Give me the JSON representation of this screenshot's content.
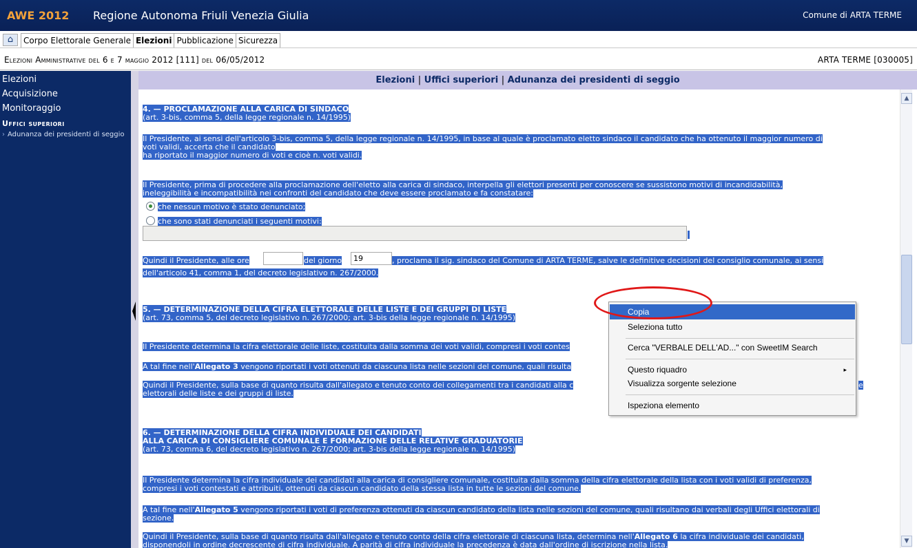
{
  "header": {
    "logo": "AWE 2012",
    "region": "Regione Autonoma Friuli Venezia Giulia",
    "comune": "Comune di ARTA TERME"
  },
  "menu": {
    "tabs": [
      "Corpo Elettorale Generale",
      "Elezioni",
      "Pubblicazione",
      "Sicurezza"
    ],
    "active_tab": "Elezioni"
  },
  "infobar": {
    "election": "Elezioni Amministrative del 6 e 7 maggio 2012 [111] del 06/05/2012",
    "comune_code": "ARTA TERME [030005]"
  },
  "sidebar": {
    "items": [
      "Elezioni",
      "Acquisizione",
      "Monitoraggio"
    ],
    "section": "Uffici superiori",
    "subitem": "Adunanza dei presidenti di seggio"
  },
  "breadcrumb": {
    "part1": "Elezioni",
    "sep": "|",
    "part2": "Uffici superiori",
    "part3": "Adunanza dei presidenti di seggio"
  },
  "content": {
    "s4_title": "4. — PROCLAMAZIONE ALLA CARICA DI SINDACO",
    "s4_sub": "(art. 3-bis, comma 5, della legge regionale n. 14/1995)",
    "s4_p1_l1": "Il Presidente, ai sensi dell'articolo 3-bis, comma 5, della legge regionale n. 14/1995, in base al quale è proclamato eletto sindaco il candidato che ha ottenuto il maggior numero di",
    "s4_p1_l2": "voti validi, accerta che il candidato",
    "s4_p1_l3": "ha riportato il maggior numero di voti e cioè n. voti validi.",
    "s4_p2_l1": "Il Presidente, prima di procedere alla proclamazione dell'eletto alla carica di sindaco, interpella gli elettori presenti per conoscere se sussistono motivi di incandidabilità,",
    "s4_p2_l2": "ineleggibilità e incompatibilità nei confronti del candidato che deve essere proclamato e fa constatare:",
    "radio1": "che nessun motivo è stato denunciato;",
    "radio2": "che sono stati denunciati i seguenti motivi:",
    "s4_p3_a": "Quindi il Presidente, alle ore",
    "s4_p3_b": "del giorno",
    "giorno_value": "19",
    "s4_p3_c": ", proclama il sig. sindaco del Comune di ARTA TERME, salve le definitive decisioni del consiglio comunale, ai sensi",
    "s4_p3_l2": "dell'articolo 41, comma 1, del decreto legislativo n. 267/2000.",
    "s5_title": "5. — DETERMINAZIONE DELLA CIFRA ELETTORALE DELLE LISTE E DEI GRUPPI DI LISTE",
    "s5_sub": "(art. 73, comma 5, del decreto legislativo n. 267/2000; art. 3-bis della legge regionale n. 14/1995)",
    "s5_p1": "Il Presidente determina la cifra elettorale delle liste, costituita dalla somma dei voti validi, compresi i voti contes",
    "s5_p2_a": "A tal fine nell'",
    "s5_p2_b": "Allegato 3",
    "s5_p2_c": " vengono riportati i voti ottenuti da ciascuna lista nelle sezioni del comune, quali risulta",
    "s5_p3_l1": "Quindi il Presidente, sulla base di quanto risulta dall'allegato e tenuto conto dei collegamenti tra i candidati alla c",
    "s5_p3_l1_tail": "e",
    "s5_p3_l2": "elettorali delle liste e dei gruppi di liste.",
    "s6_title_l1": "6. — DETERMINAZIONE DELLA CIFRA INDIVIDUALE DEI CANDIDATI",
    "s6_title_l2": "ALLA CARICA DI CONSIGLIERE COMUNALE E FORMAZIONE DELLE RELATIVE GRADUATORIE",
    "s6_sub": "(art. 73, comma 6, del decreto legislativo n. 267/2000; art. 3-bis della legge regionale n. 14/1995)",
    "s6_p1_l1": "Il Presidente determina la cifra individuale dei candidati alla carica di consigliere comunale, costituita dalla somma della cifra elettorale della lista con i voti validi di preferenza,",
    "s6_p1_l2": "compresi i voti contestati e attribuiti, ottenuti da ciascun candidato della stessa lista in tutte le sezioni del comune.",
    "s6_p2_a": "A tal fine nell'",
    "s6_p2_b": "Allegato 5",
    "s6_p2_c": " vengono riportati i voti di preferenza ottenuti da ciascun candidato della lista nelle sezioni del comune, quali risultano dai verbali degli Uffici elettorali di",
    "s6_p2_l2": "sezione.",
    "s6_p3_a": "Quindi il Presidente, sulla base di quanto risulta dall'allegato e tenuto conto della cifra elettorale di ciascuna lista, determina nell'",
    "s6_p3_b": "Allegato 6",
    "s6_p3_c": " la cifra individuale dei candidati,",
    "s6_p3_l2": "disponendoli in ordine decrescente di cifra individuale. A parità di cifra individuale la precedenza è data dall'ordine di iscrizione nella lista."
  },
  "context_menu": {
    "items": [
      "Copia",
      "Seleziona tutto",
      "Cerca \"VERBALE DELL'AD...\" con SweetIM Search",
      "Questo riquadro",
      "Visualizza sorgente selezione",
      "Ispeziona elemento"
    ],
    "highlighted": "Copia",
    "submenu_arrow": "▸"
  },
  "colors": {
    "header_bg": "#0c2a66",
    "logo": "#f3a23a",
    "selection": "#3264c8",
    "annotation": "#e01818"
  }
}
